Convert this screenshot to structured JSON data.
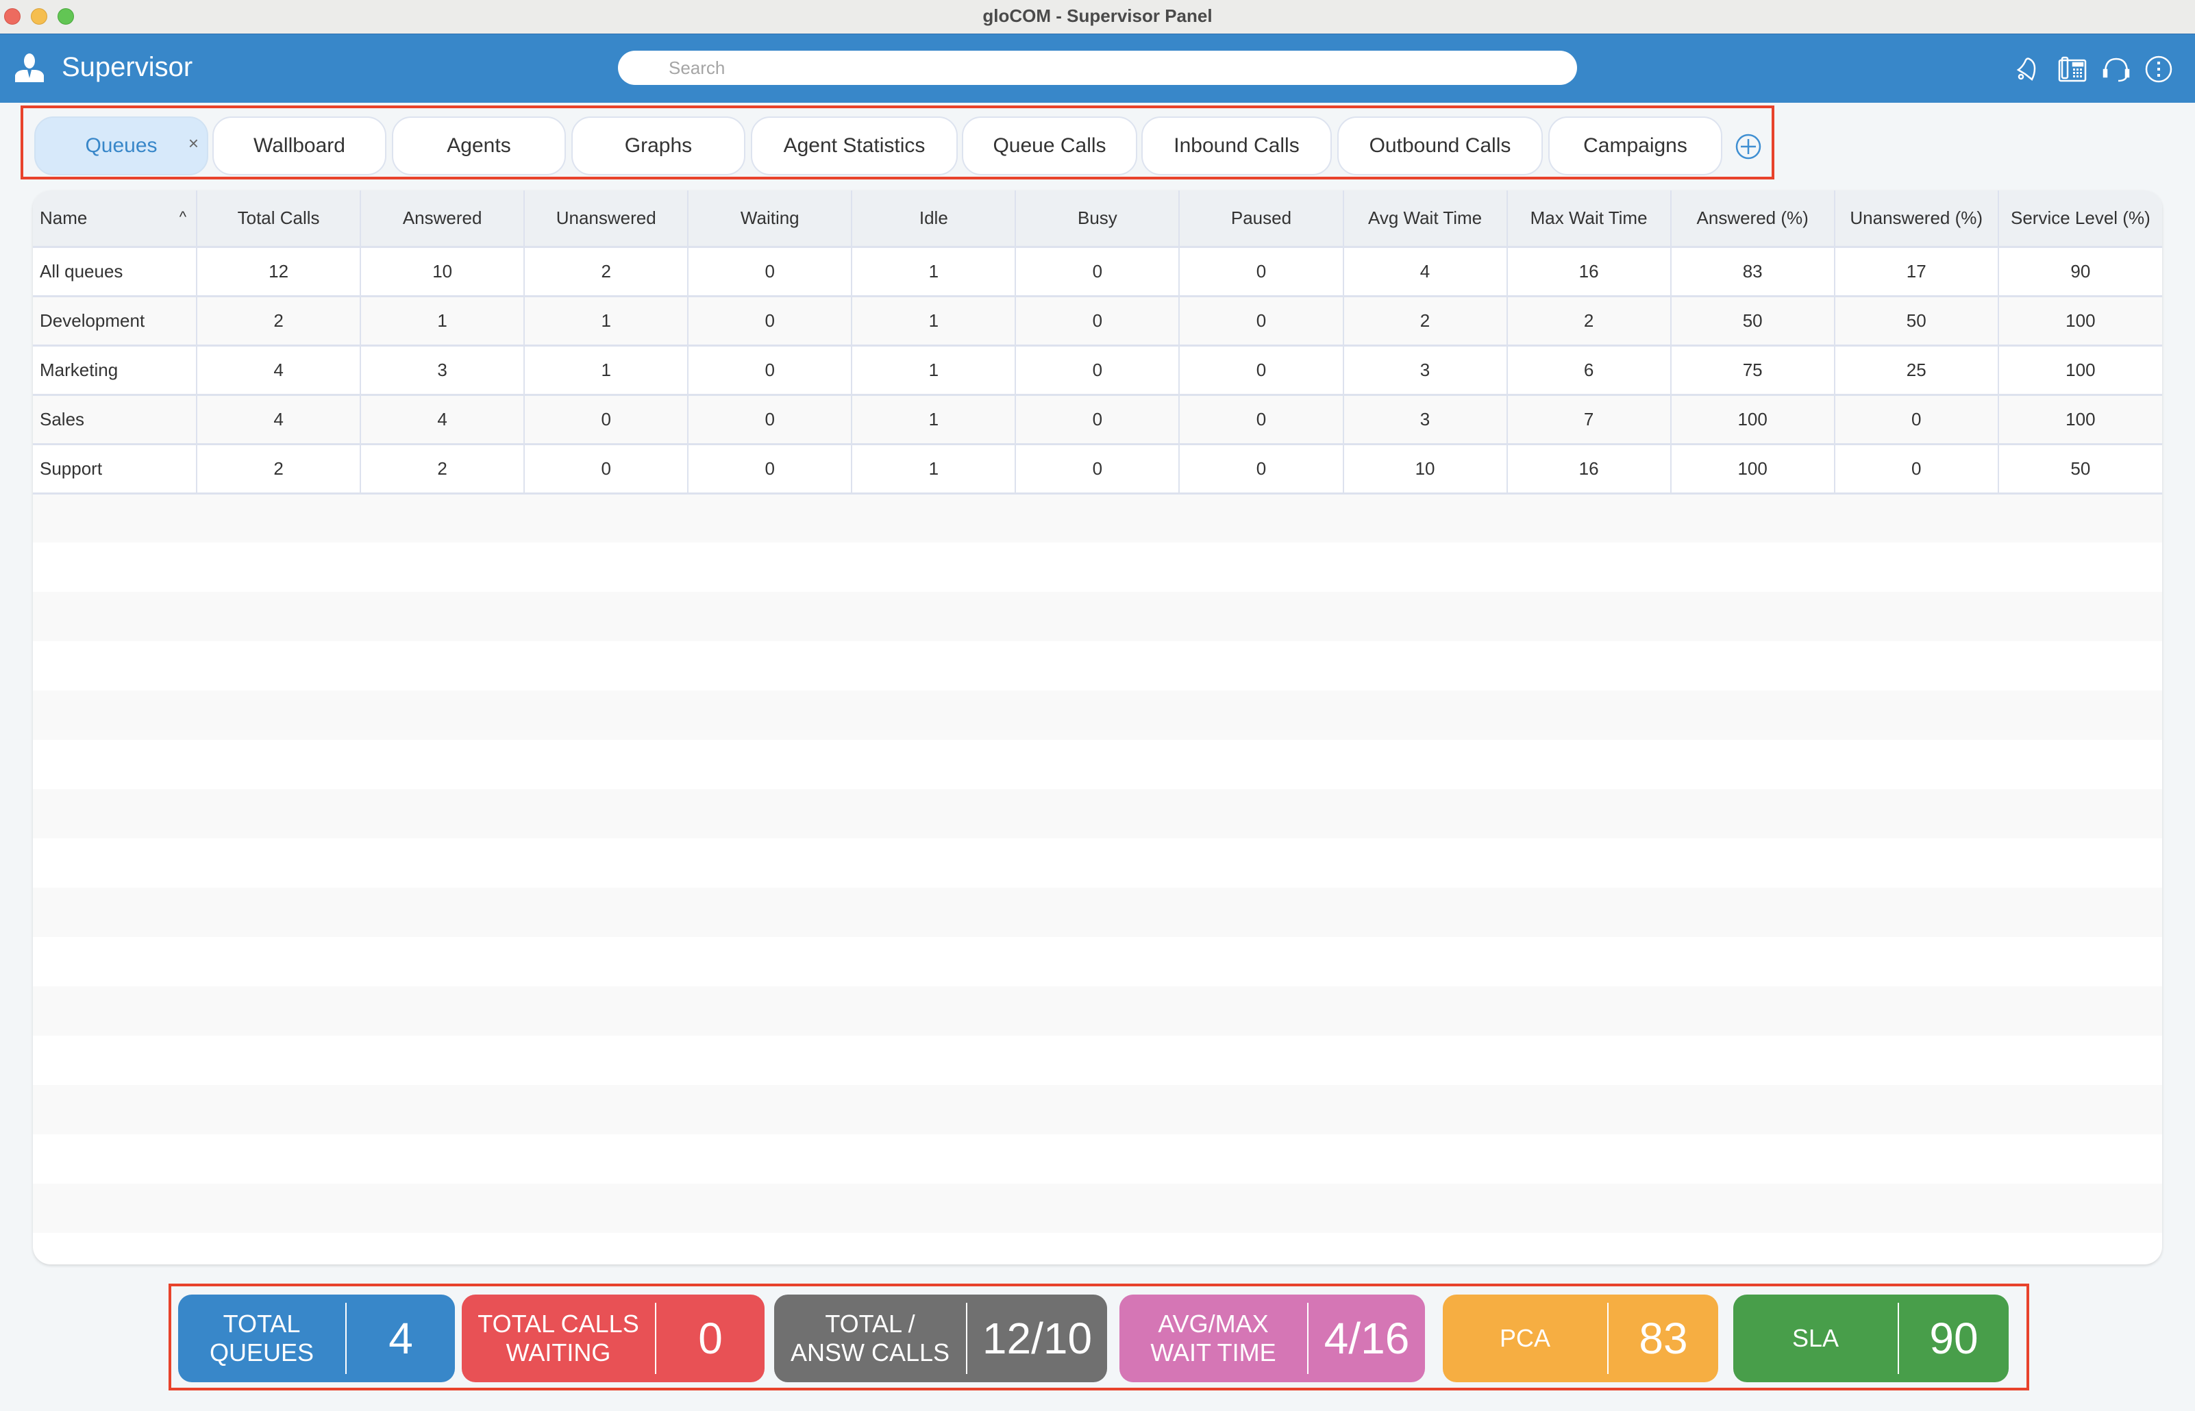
{
  "window": {
    "title": "gloCOM - Supervisor Panel"
  },
  "header": {
    "app_title": "Supervisor",
    "user_icon": "supervisor-user-icon",
    "search_placeholder": "Search",
    "search_value": "",
    "icons": [
      "bell-icon",
      "desk-phone-icon",
      "headset-icon",
      "more-options-icon"
    ]
  },
  "tabs": [
    {
      "label": "Queues",
      "active": true,
      "closable": true
    },
    {
      "label": "Wallboard",
      "active": false
    },
    {
      "label": "Agents",
      "active": false
    },
    {
      "label": "Graphs",
      "active": false
    },
    {
      "label": "Agent Statistics",
      "active": false
    },
    {
      "label": "Queue Calls",
      "active": false
    },
    {
      "label": "Inbound Calls",
      "active": false
    },
    {
      "label": "Outbound Calls",
      "active": false
    },
    {
      "label": "Campaigns",
      "active": false
    }
  ],
  "tab_close_symbol": "×",
  "table": {
    "sort_column": "Name",
    "sort_direction": "ascending",
    "sort_symbol": "^",
    "columns": [
      "Name",
      "Total Calls",
      "Answered",
      "Unanswered",
      "Waiting",
      "Idle",
      "Busy",
      "Paused",
      "Avg Wait Time",
      "Max Wait Time",
      "Answered (%)",
      "Unanswered (%)",
      "Service Level (%)"
    ],
    "rows": [
      [
        "All queues",
        "12",
        "10",
        "2",
        "0",
        "1",
        "0",
        "0",
        "4",
        "16",
        "83",
        "17",
        "90"
      ],
      [
        "Development",
        "2",
        "1",
        "1",
        "0",
        "1",
        "0",
        "0",
        "2",
        "2",
        "50",
        "50",
        "100"
      ],
      [
        "Marketing",
        "4",
        "3",
        "1",
        "0",
        "1",
        "0",
        "0",
        "3",
        "6",
        "75",
        "25",
        "100"
      ],
      [
        "Sales",
        "4",
        "4",
        "0",
        "0",
        "1",
        "0",
        "0",
        "3",
        "7",
        "100",
        "0",
        "100"
      ],
      [
        "Support",
        "2",
        "2",
        "0",
        "0",
        "1",
        "0",
        "0",
        "10",
        "16",
        "100",
        "0",
        "50"
      ]
    ]
  },
  "stats": [
    {
      "label_line1": "TOTAL",
      "label_line2": "QUEUES",
      "value": "4",
      "color": "#3887c9"
    },
    {
      "label_line1": "TOTAL CALLS",
      "label_line2": "WAITING",
      "value": "0",
      "color": "#e85155"
    },
    {
      "label_line1": "TOTAL /",
      "label_line2": "ANSW CALLS",
      "value": "12/10",
      "color": "#707070"
    },
    {
      "label_line1": "AVG/MAX",
      "label_line2": "WAIT TIME",
      "value": "4/16",
      "color": "#d576b5"
    },
    {
      "label_line1": "PCA",
      "label_line2": "",
      "value": "83",
      "color": "#f6ae42"
    },
    {
      "label_line1": "SLA",
      "label_line2": "",
      "value": "90",
      "color": "#489e4a"
    }
  ],
  "colors": {
    "header_blue": "#3887c9",
    "active_tab_bg": "#d7e9fa",
    "highlight_box": "#e8432c"
  }
}
